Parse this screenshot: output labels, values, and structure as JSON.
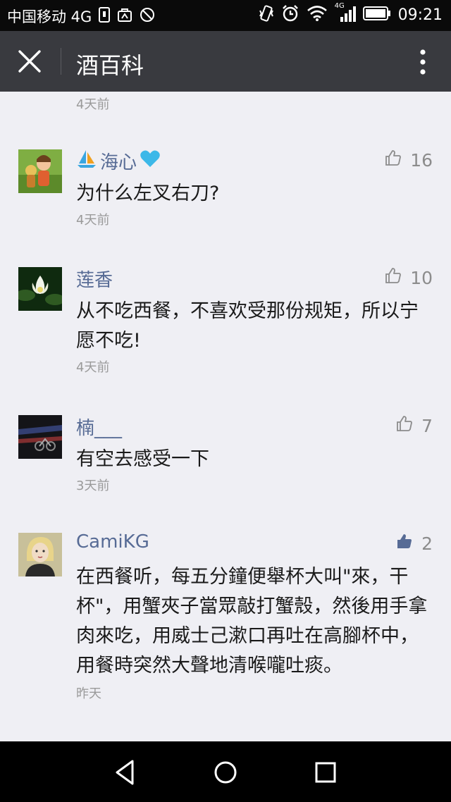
{
  "status_bar": {
    "carrier": "中国移动 4G",
    "network_badge": "4G",
    "time": "09:21"
  },
  "header": {
    "title": "酒百科"
  },
  "top_comment_time": "4天前",
  "comments": [
    {
      "username": "海心",
      "text": "为什么左叉右刀?",
      "time": "4天前",
      "likes": "16",
      "liked": false
    },
    {
      "username": "莲香",
      "text": "从不吃西餐，不喜欢受那份规矩，所以宁愿不吃!",
      "time": "4天前",
      "likes": "10",
      "liked": false
    },
    {
      "username": "楠___",
      "text": "有空去感受一下",
      "time": "3天前",
      "likes": "7",
      "liked": false
    },
    {
      "username": "CamiKG",
      "text": "在西餐听，每五分鐘便舉杯大叫\"來，干杯\"，用蟹夾子當眾敲打蟹殼，然後用手拿肉來吃，用威士己漱口再吐在高腳杯中，用餐時突然大聲地清喉嚨吐痰。",
      "time": "昨天",
      "likes": "2",
      "liked": true
    }
  ],
  "colors": {
    "status_bar": "#0a0a0a",
    "title_bar": "#393a3f",
    "background": "#efeff4",
    "username": "#576b95",
    "like_active": "#576b95",
    "like_inactive": "#8c8c8c"
  },
  "icons": {
    "close": "close-icon",
    "more": "more-vertical-icon",
    "like": "thumbs-up-icon",
    "nav_back": "triangle-back-icon",
    "nav_home": "circle-home-icon",
    "nav_recent": "square-recent-icon"
  }
}
